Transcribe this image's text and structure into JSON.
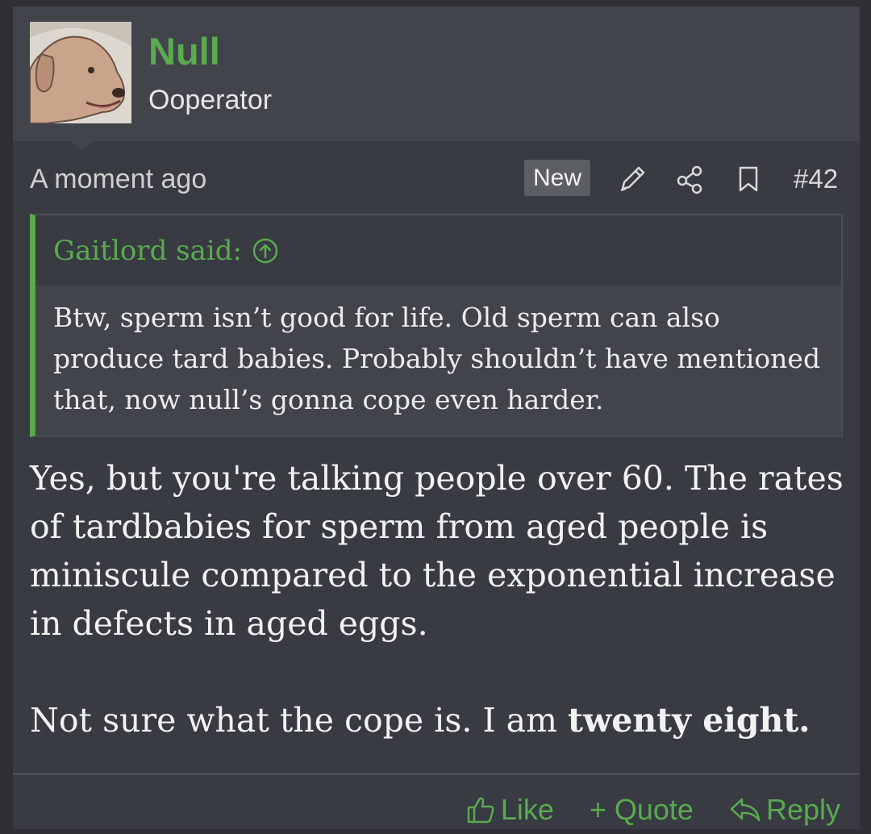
{
  "user": {
    "name": "Null",
    "title": "Ooperator",
    "avatar_icon": "dog-avatar"
  },
  "meta": {
    "time": "A moment ago",
    "badge": "New",
    "post_number": "#42",
    "icons": [
      "edit-pencil-icon",
      "share-icon",
      "bookmark-icon"
    ]
  },
  "quote": {
    "author_line": "Gaitlord said:",
    "text": "Btw, sperm isn’t good for life. Old sperm can also produce tard babies. Probably shouldn’t have mentioned that, now null’s gonna cope even harder."
  },
  "post": {
    "paragraph1": "Yes, but you're talking people over 60. The rates of tardbabies for sperm from aged people is miniscule compared to the exponential increase in defects in aged eggs.",
    "paragraph2_prefix": "Not sure what the cope is. I am ",
    "paragraph2_bold": "twenty eight."
  },
  "actions": {
    "like": "Like",
    "quote": "+ Quote",
    "reply": "Reply"
  },
  "colors": {
    "accent": "#5aaa4f",
    "background": "#383b42",
    "header": "#41444b"
  }
}
